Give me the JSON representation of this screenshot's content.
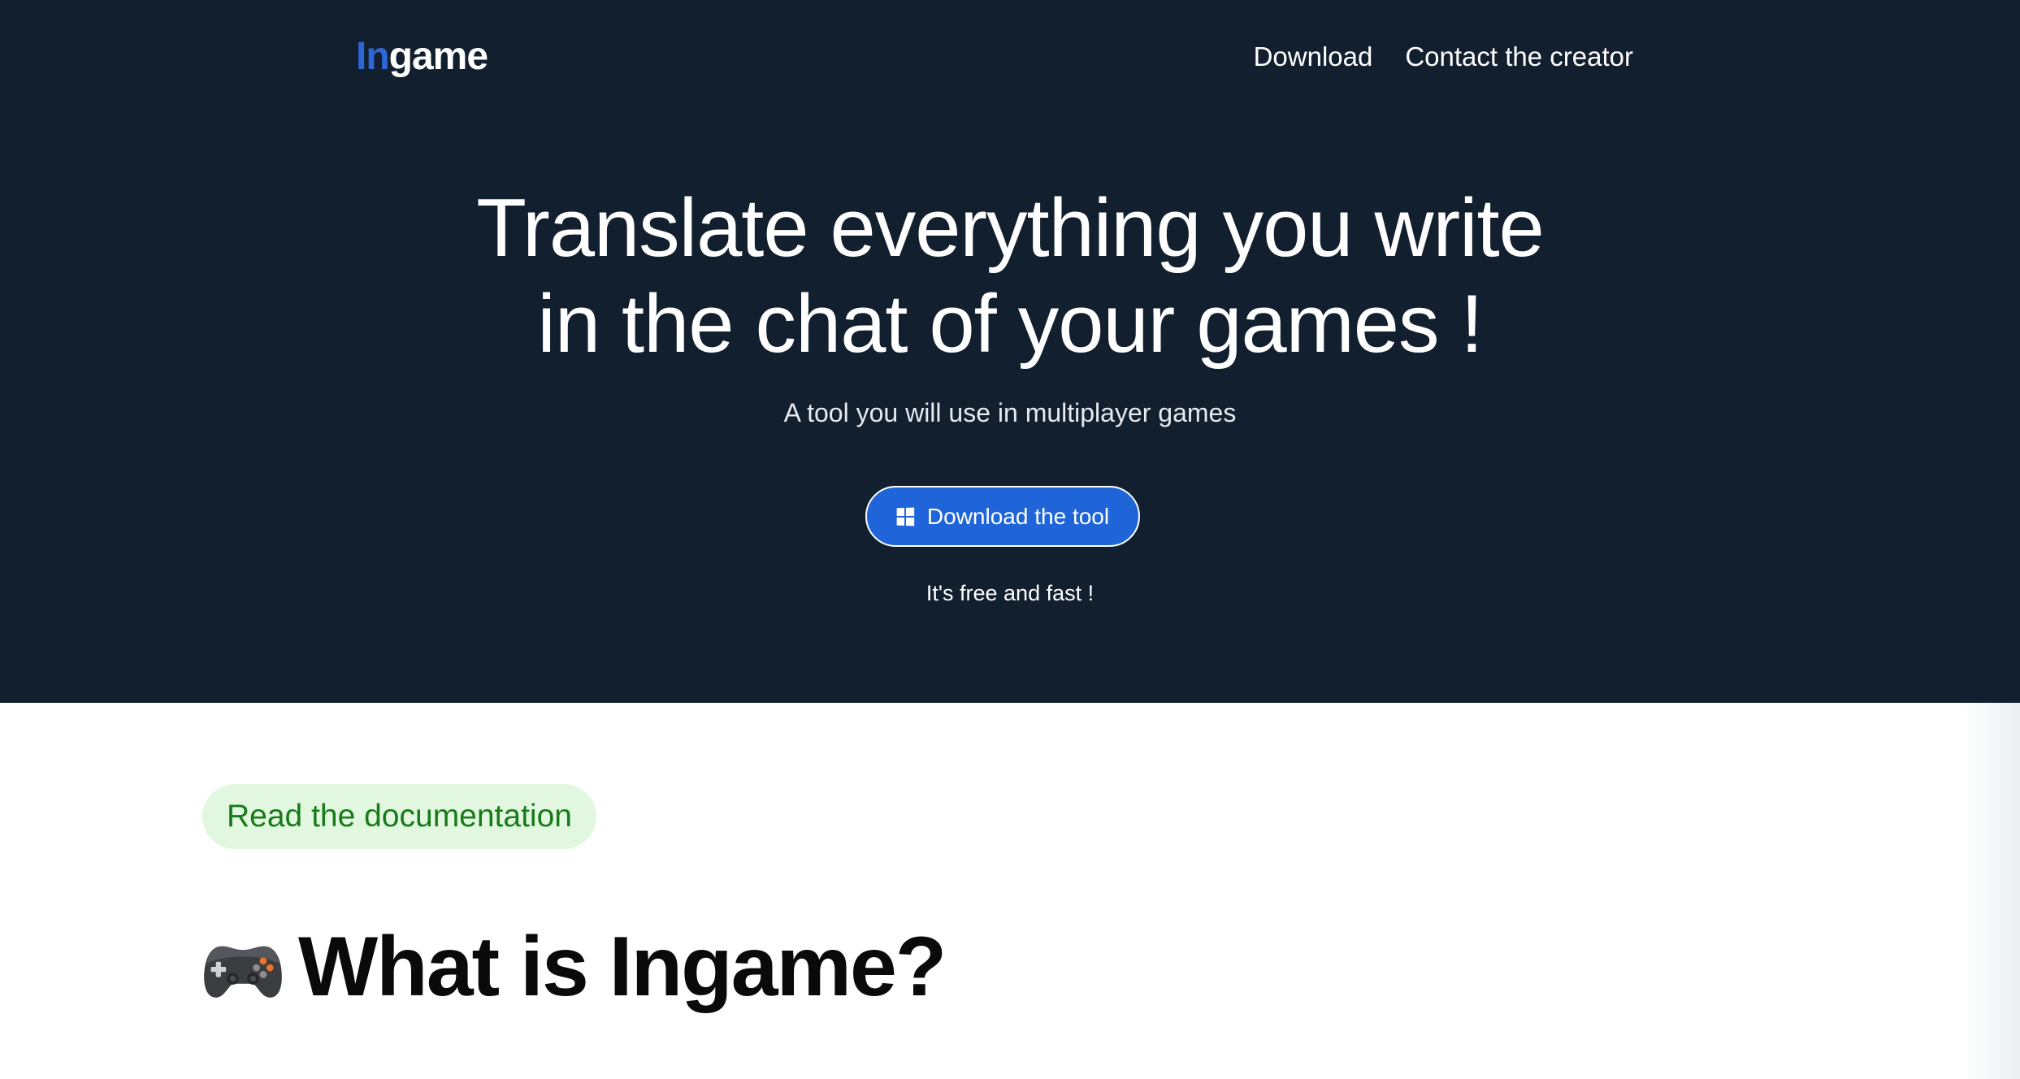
{
  "colors": {
    "hero_bg": "#121f2e",
    "accent_blue": "#1f64d8",
    "logo_blue": "#2f66d6",
    "pill_bg": "#e2f7df",
    "pill_text": "#187a18"
  },
  "header": {
    "logo_prefix": "In",
    "logo_suffix": "game",
    "nav": {
      "download": "Download",
      "contact": "Contact the creator"
    }
  },
  "hero": {
    "headline_line1": "Translate everything you write",
    "headline_line2": "in the chat of your games !",
    "subtitle": "A tool you will use in multiplayer games",
    "button_icon": "windows-icon",
    "button_label": "Download the tool",
    "note": "It's free and fast !"
  },
  "content": {
    "doc_link": "Read the documentation",
    "section_icon": "gamepad-icon",
    "section_title": "What is Ingame?"
  }
}
